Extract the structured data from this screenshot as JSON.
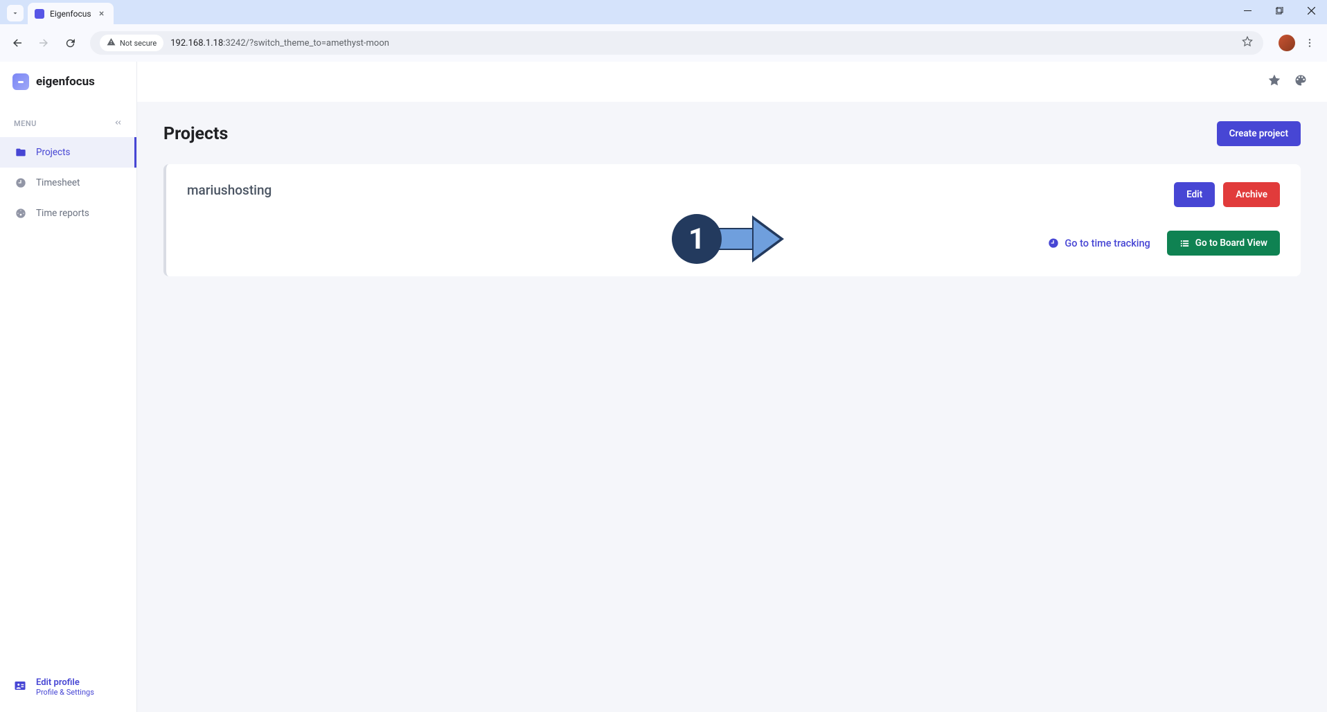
{
  "browser": {
    "tab_title": "Eigenfocus",
    "security_label": "Not secure",
    "url_host": "192.168.1.18",
    "url_port_path": ":3242/?switch_theme_to=amethyst-moon"
  },
  "app": {
    "name": "eigenfocus"
  },
  "sidebar": {
    "menu_label": "MENU",
    "items": [
      {
        "label": "Projects"
      },
      {
        "label": "Timesheet"
      },
      {
        "label": "Time reports"
      }
    ],
    "footer": {
      "title": "Edit profile",
      "subtitle": "Profile & Settings"
    }
  },
  "page": {
    "title": "Projects",
    "create_button": "Create project"
  },
  "project": {
    "name": "mariushosting",
    "edit_button": "Edit",
    "archive_button": "Archive",
    "time_tracking_link": "Go to time tracking",
    "board_view_button": "Go to Board View"
  },
  "annotation": {
    "number": "1"
  }
}
